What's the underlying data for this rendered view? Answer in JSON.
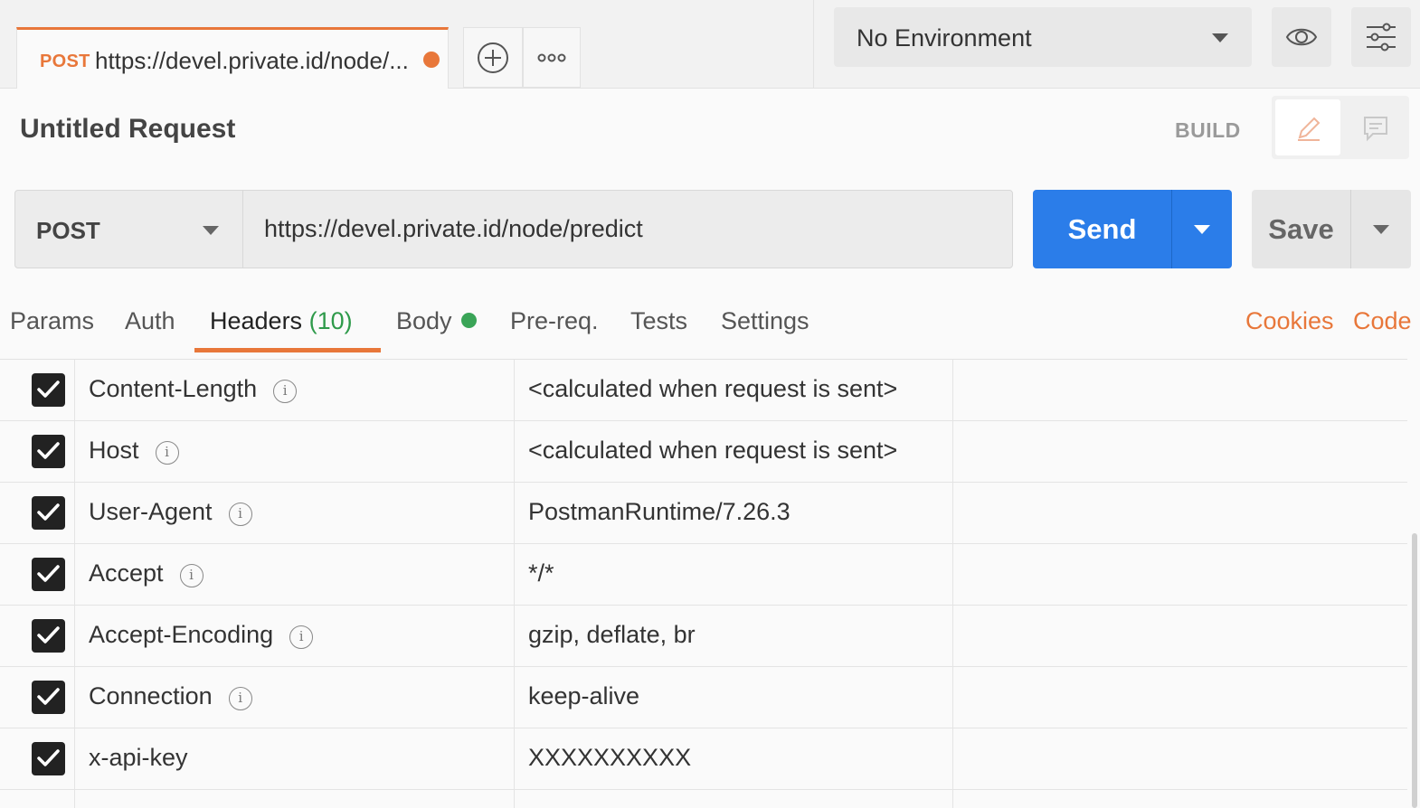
{
  "tab": {
    "method": "POST",
    "url": "https://devel.private.id/node/...",
    "add_label": "+",
    "more_label": "ooo"
  },
  "environment": {
    "selected": "No Environment"
  },
  "request": {
    "title": "Untitled Request",
    "mode_label": "BUILD",
    "method": "POST",
    "url": "https://devel.private.id/node/predict"
  },
  "actions": {
    "send_label": "Send",
    "save_label": "Save"
  },
  "subtabs": {
    "params": "Params",
    "auth": "Auth",
    "headers": "Headers",
    "headers_count": "(10)",
    "body": "Body",
    "prereq": "Pre-req.",
    "tests": "Tests",
    "settings": "Settings",
    "cookies": "Cookies",
    "code": "Code"
  },
  "headers": [
    {
      "key": "Content-Length",
      "value": "<calculated when request is sent>",
      "checked": true,
      "info": true
    },
    {
      "key": "Host",
      "value": "<calculated when request is sent>",
      "checked": true,
      "info": true
    },
    {
      "key": "User-Agent",
      "value": "PostmanRuntime/7.26.3",
      "checked": true,
      "info": true
    },
    {
      "key": "Accept",
      "value": "*/*",
      "checked": true,
      "info": true
    },
    {
      "key": "Accept-Encoding",
      "value": "gzip, deflate, br",
      "checked": true,
      "info": true
    },
    {
      "key": "Connection",
      "value": "keep-alive",
      "checked": true,
      "info": true
    },
    {
      "key": "x-api-key",
      "value": "XXXXXXXXXX",
      "checked": true,
      "info": false
    }
  ],
  "colors": {
    "accent": "#e8773a",
    "send": "#2b7de9",
    "success": "#3aa457"
  }
}
